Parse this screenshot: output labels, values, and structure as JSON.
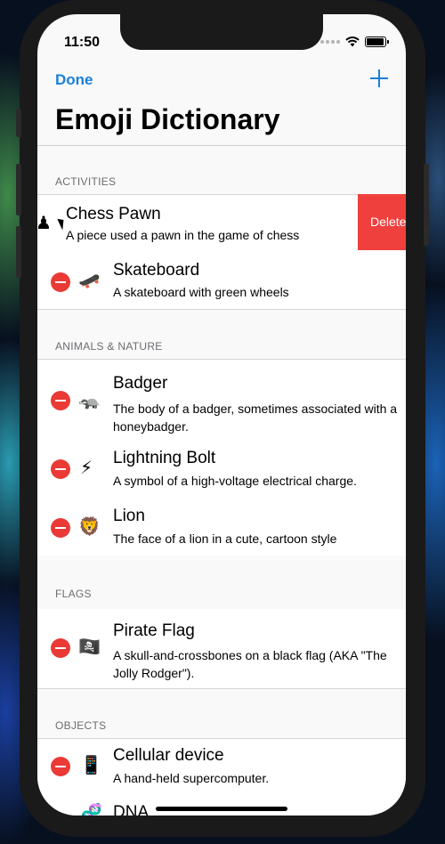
{
  "status": {
    "time": "11:50"
  },
  "nav": {
    "done_label": "Done",
    "title": "Emoji Dictionary"
  },
  "sections": [
    {
      "header": "ACTIVITIES",
      "items": [
        {
          "emoji": "♟",
          "title": "Chess Pawn",
          "desc": "A piece used a pawn in the game of chess",
          "swipe_action": "Delete"
        },
        {
          "emoji": "🛹",
          "title": "Skateboard",
          "desc": "A skateboard with green wheels"
        }
      ]
    },
    {
      "header": "ANIMALS & NATURE",
      "items": [
        {
          "emoji": "🦡",
          "title": "Badger",
          "desc": "The body of a badger, sometimes associated with a honeybadger."
        },
        {
          "emoji": "⚡",
          "title": "Lightning Bolt",
          "desc": "A symbol of a high-voltage electrical charge."
        },
        {
          "emoji": "🦁",
          "title": "Lion",
          "desc": "The face of a lion in a cute, cartoon style"
        }
      ]
    },
    {
      "header": "FLAGS",
      "items": [
        {
          "emoji": "🏴‍☠️",
          "title": "Pirate Flag",
          "desc": "A skull-and-crossbones on a black flag (AKA \"The Jolly Rodger\")."
        }
      ]
    },
    {
      "header": "OBJECTS",
      "items": [
        {
          "emoji": "📱",
          "title": "Cellular device",
          "desc": "A hand-held supercomputer."
        },
        {
          "emoji": "🧬",
          "title": "DNA",
          "desc": ""
        }
      ]
    }
  ],
  "colors": {
    "accent": "#1a7fd9",
    "delete_red": "#ea3a36",
    "swipe_red": "#f0403d"
  }
}
